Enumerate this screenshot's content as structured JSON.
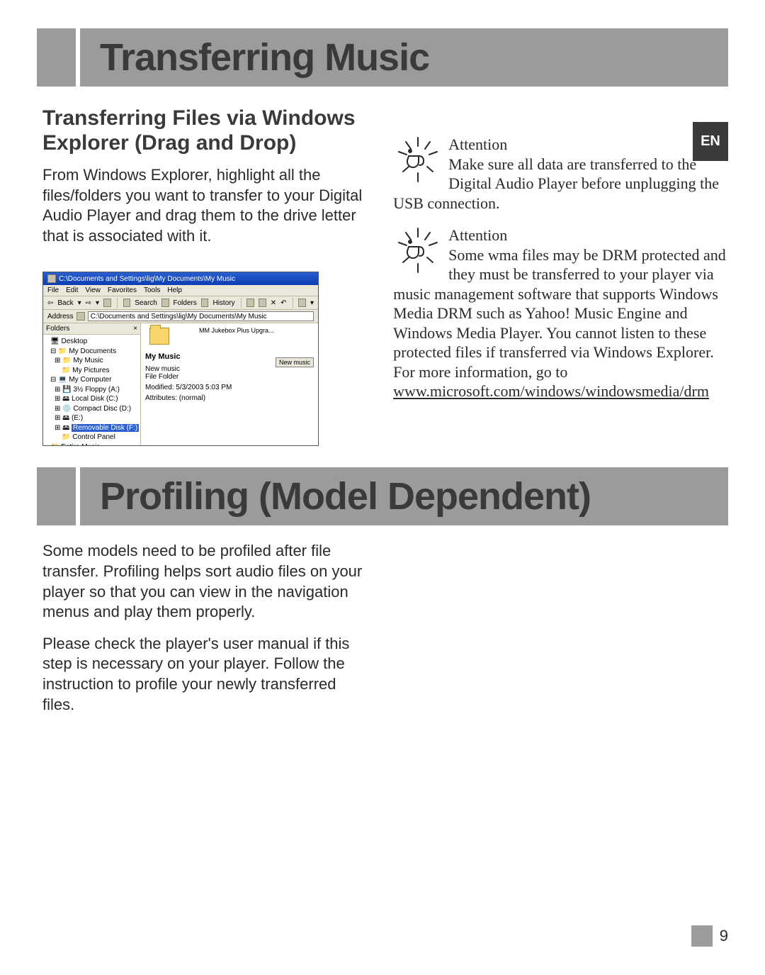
{
  "language_tab": "EN",
  "page_number": "9",
  "section1": {
    "title": "Transferring Music",
    "subhead": "Transferring Files via Windows Explorer (Drag and Drop)",
    "body": "From Windows Explorer, highlight all the files/folders you want to transfer to your Digital Audio Player and drag them to the drive letter that is associated with it."
  },
  "attention1": {
    "heading": "Attention",
    "text": "Make sure all data are transferred to the Digital Audio Player before unplugging the USB connection."
  },
  "attention2": {
    "heading": "Attention",
    "text_part1": "Some wma files may be DRM protected and they must be transferred to your player via music management software that supports Windows Media DRM such as Yahoo! Music Engine and Windows Media Player. You cannot listen to these protected files if transferred via Windows Explorer.",
    "text_part2": "For more information, go to ",
    "link": "www.microsoft.com/windows/windowsmedia/drm"
  },
  "section2": {
    "title": "Profiling (Model Dependent)",
    "para1": "Some models need to be profiled after file transfer. Profiling helps sort audio files on your player so that you can view in the navigation menus and play them properly.",
    "para2": "Please check the player's user manual if this step is necessary on your player. Follow the instruction to profile your newly transferred files."
  },
  "explorer": {
    "title": "C:\\Documents and Settings\\lig\\My Documents\\My Music",
    "menus": [
      "File",
      "Edit",
      "View",
      "Favorites",
      "Tools",
      "Help"
    ],
    "toolbar": {
      "back": "Back",
      "search": "Search",
      "folders": "Folders",
      "history": "History"
    },
    "address_label": "Address",
    "address_value": "C:\\Documents and Settings\\lig\\My Documents\\My Music",
    "folders_label": "Folders",
    "tree": [
      "Desktop",
      "My Documents",
      "My Music",
      "My Pictures",
      "My Computer",
      "3½ Floppy (A:)",
      "Local Disk (C:)",
      "Compact Disc (D:)",
      "(E:)",
      "Removable Disk (F:)",
      "Control Panel",
      "Entire Music"
    ],
    "selected_tree_item": "Removable Disk (F:)",
    "content_icons": [
      "MM Jukebox Plus Upgra...",
      "New music"
    ],
    "details_title": "My Music",
    "details_lines": [
      "New music",
      "File Folder",
      "Modified: 5/3/2003 5:03 PM",
      "Attributes: (normal)"
    ],
    "new_button": "New music"
  }
}
